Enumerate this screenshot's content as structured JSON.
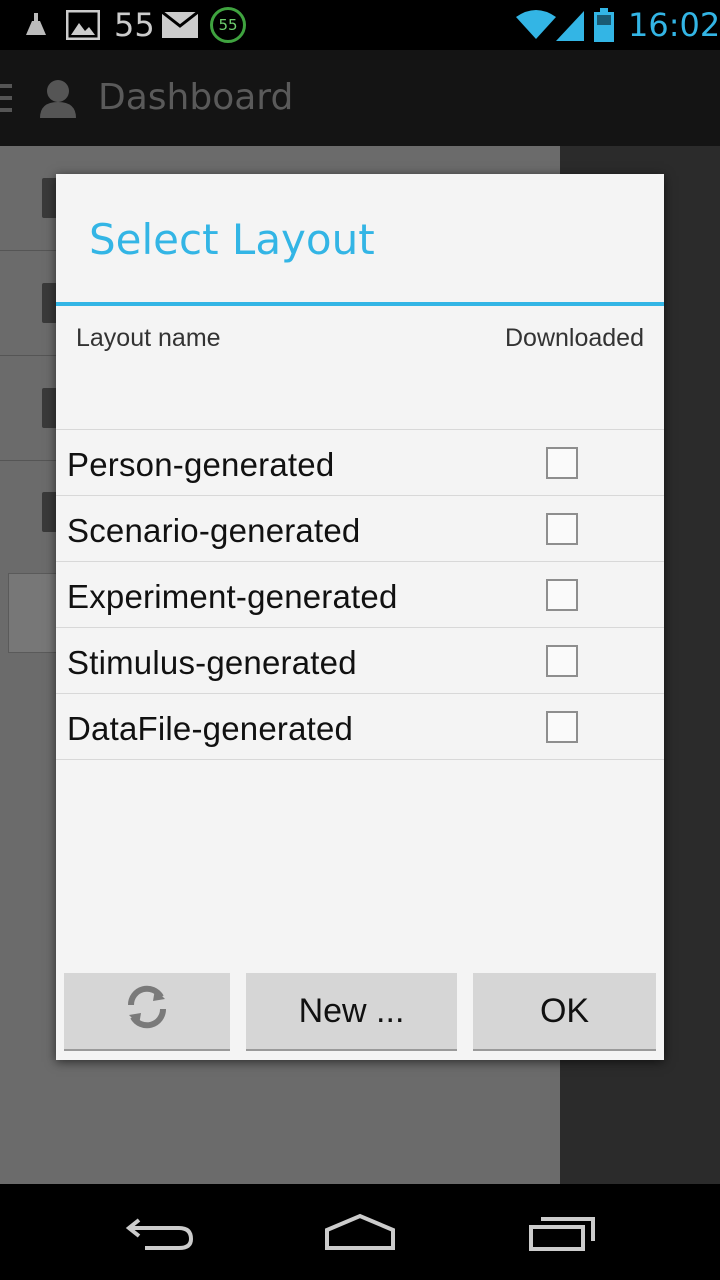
{
  "status_bar": {
    "notification_count": "55",
    "badge_number": "55",
    "time": "16:02",
    "icons": [
      "cleaner-icon",
      "image-icon",
      "mail-icon",
      "timer-badge-icon",
      "wifi-icon",
      "signal-icon",
      "battery-icon"
    ]
  },
  "action_bar": {
    "title": "Dashboard",
    "icons": [
      "drawer-icon",
      "person-icon"
    ]
  },
  "dialog": {
    "title": "Select Layout",
    "columns": {
      "name": "Layout name",
      "downloaded": "Downloaded"
    },
    "layouts": [
      {
        "name": "Person-generated",
        "downloaded": false
      },
      {
        "name": "Scenario-generated",
        "downloaded": false
      },
      {
        "name": "Experiment-generated",
        "downloaded": false
      },
      {
        "name": "Stimulus-generated",
        "downloaded": false
      },
      {
        "name": "DataFile-generated",
        "downloaded": false
      }
    ],
    "buttons": {
      "refresh_icon": "refresh-icon",
      "new_label": "New ...",
      "ok_label": "OK"
    }
  },
  "nav_bar": {
    "icons": [
      "back-icon",
      "home-icon",
      "recents-icon"
    ]
  },
  "colors": {
    "accent": "#33b5e5",
    "dialog_bg": "#f4f4f4",
    "button_bg": "#d6d6d6"
  }
}
